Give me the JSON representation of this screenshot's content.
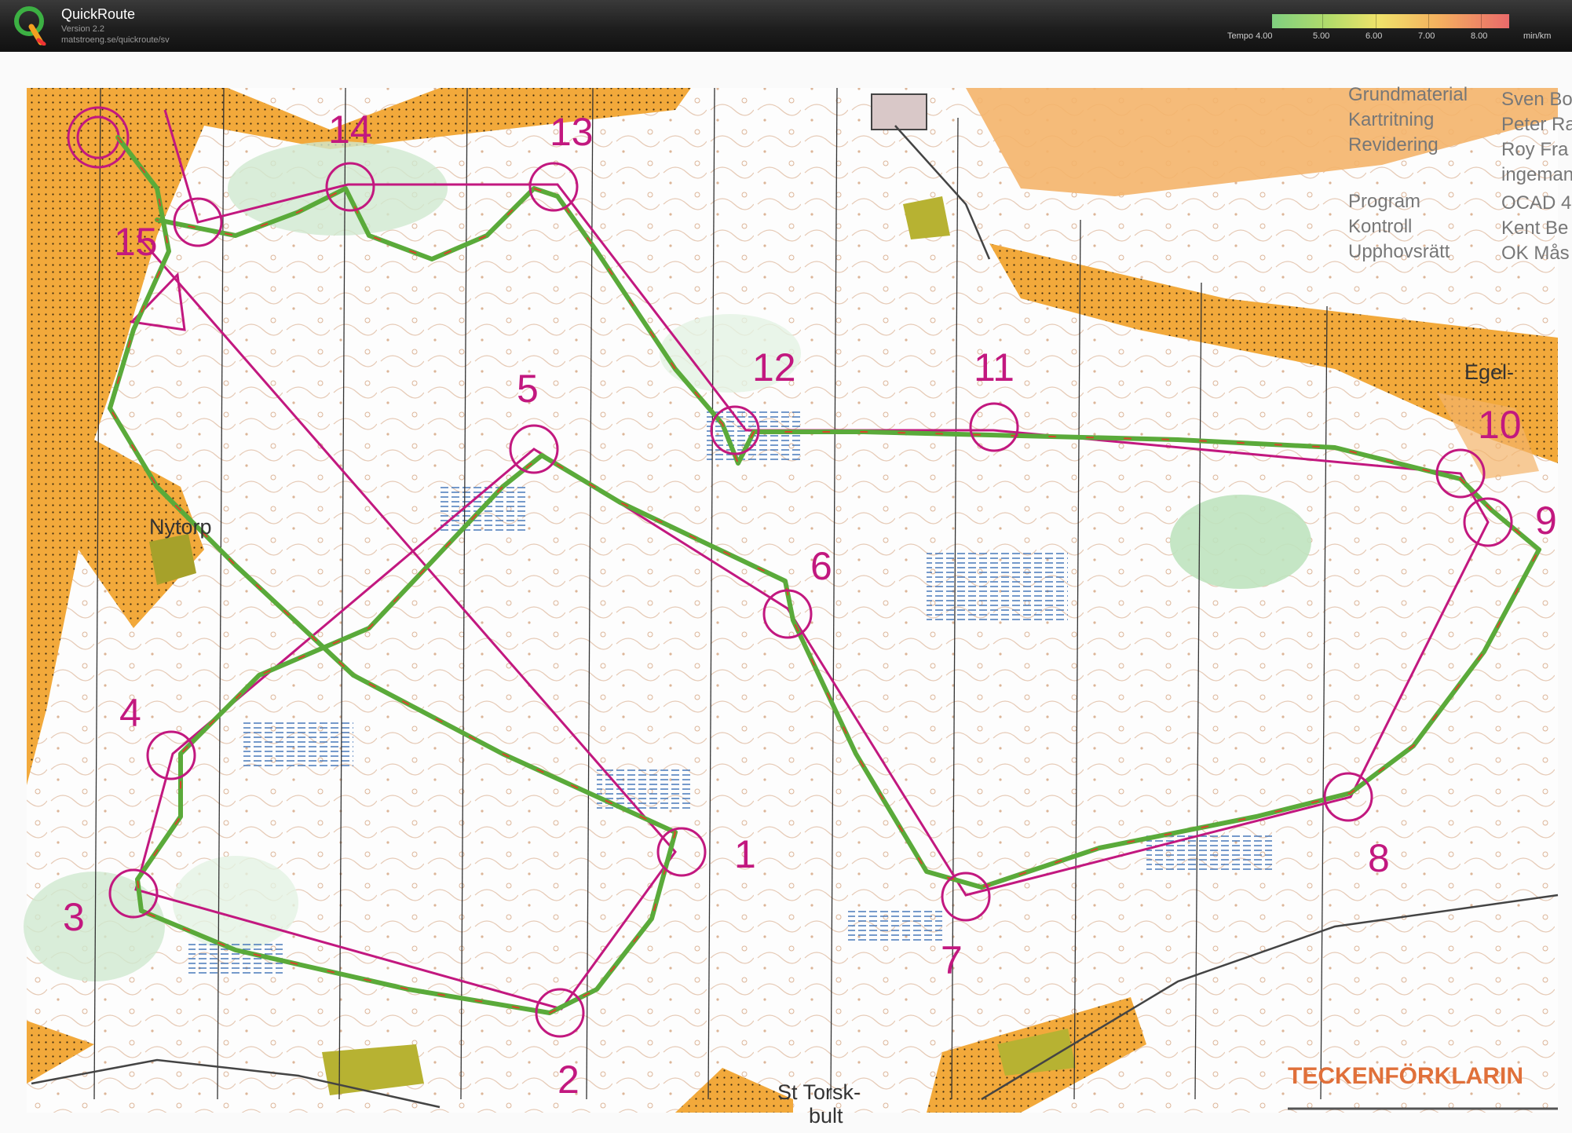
{
  "app": {
    "title": "QuickRoute",
    "version": "Version 2.2",
    "url": "matstroeng.se/quickroute/sv",
    "logo_letter": "Q"
  },
  "tempo_legend": {
    "label": "Tempo 4.00",
    "ticks": [
      "5.00",
      "6.00",
      "7.00",
      "8.00"
    ],
    "unit": "min/km",
    "colors": [
      "#7fcf7f",
      "#b5dc6a",
      "#f0e26a",
      "#f4b15f",
      "#ea6a6a"
    ]
  },
  "map": {
    "control_numbers": [
      "1",
      "2",
      "3",
      "4",
      "5",
      "6",
      "7",
      "8",
      "9",
      "10",
      "11",
      "12",
      "13",
      "14",
      "15"
    ],
    "place_names": [
      "Nytorp",
      "Egel-",
      "St Torsk-",
      "bult"
    ],
    "legend_title": "TECKENFÖRKLARIN",
    "credits_labels": [
      "Grundmaterial",
      "Kartritning",
      "Revidering",
      "Program",
      "Kontroll",
      "Upphovsrätt"
    ],
    "credits_values": [
      "Sven Bo",
      "Peter Ra",
      "Roy Fra",
      "ingeman",
      "OCAD 4",
      "Kent Be",
      "OK Mås"
    ],
    "colors": {
      "course": "#c2187f",
      "route_fast": "#5aaa3a",
      "route_slow": "#d7452a",
      "open_land": "#f2a93b",
      "forest": "#ffffff",
      "green": "#cfe9cf",
      "water": "#3a6fb5",
      "contour": "#c17a45"
    }
  }
}
